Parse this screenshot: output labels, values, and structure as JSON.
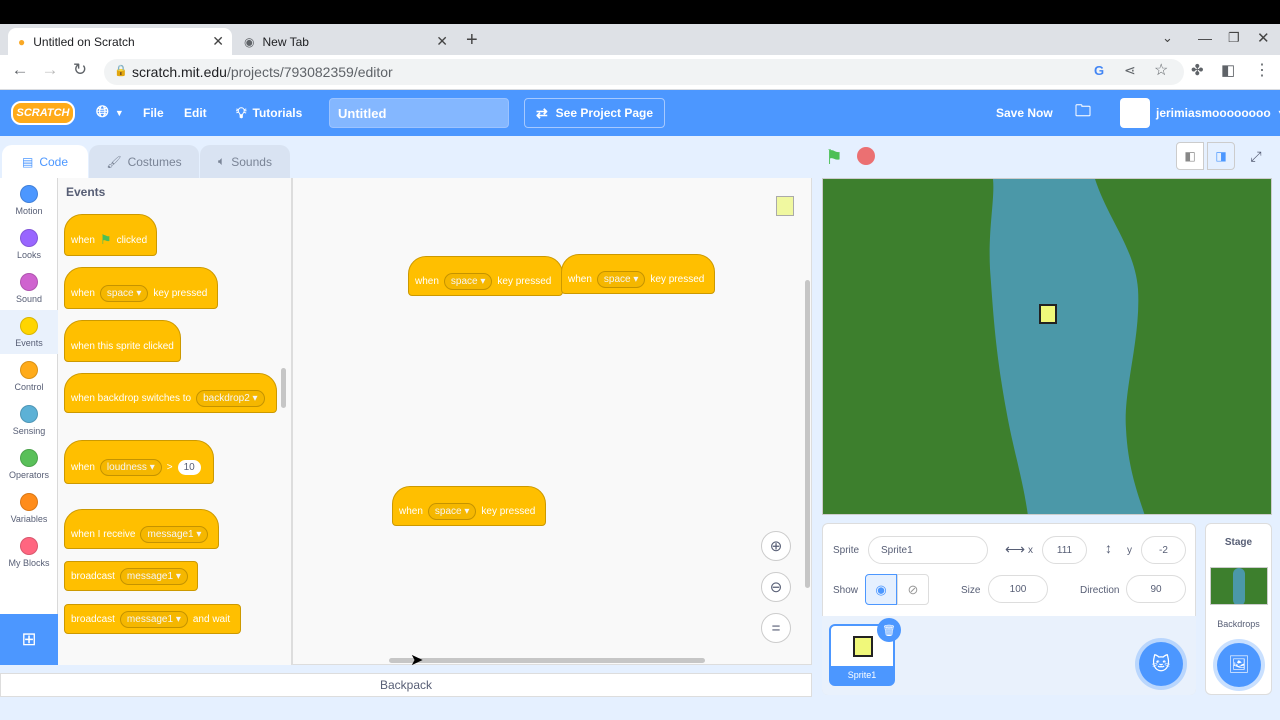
{
  "browser": {
    "tabs": [
      {
        "title": "Untitled on Scratch"
      },
      {
        "title": "New Tab"
      }
    ],
    "url_domain": "scratch.mit.edu",
    "url_path": "/projects/793082359/editor"
  },
  "menu": {
    "logo": "SCRATCH",
    "file": "File",
    "edit": "Edit",
    "tutorials": "Tutorials",
    "project_title": "Untitled",
    "see_project": "See Project Page",
    "save_now": "Save Now",
    "username": "jerimiasmoooooooo"
  },
  "editor_tabs": {
    "code": "Code",
    "costumes": "Costumes",
    "sounds": "Sounds"
  },
  "categories": [
    {
      "label": "Motion",
      "color": "#4c97ff"
    },
    {
      "label": "Looks",
      "color": "#9966ff"
    },
    {
      "label": "Sound",
      "color": "#cf63cf"
    },
    {
      "label": "Events",
      "color": "#ffd500"
    },
    {
      "label": "Control",
      "color": "#ffab19"
    },
    {
      "label": "Sensing",
      "color": "#5cb1d6"
    },
    {
      "label": "Operators",
      "color": "#59c059"
    },
    {
      "label": "Variables",
      "color": "#ff8c1a"
    },
    {
      "label": "My Blocks",
      "color": "#ff6680"
    }
  ],
  "palette": {
    "heading": "Events",
    "flag_when": "when",
    "flag_clicked": "clicked",
    "key_when": "when",
    "key_value": "space",
    "key_pressed": "key pressed",
    "sprite_clicked": "when this sprite clicked",
    "backdrop_text": "when backdrop switches to",
    "backdrop_value": "backdrop2",
    "loud_when": "when",
    "loud_value": "loudness",
    "loud_op": ">",
    "loud_num": "10",
    "receive_text": "when I receive",
    "receive_value": "message1",
    "broadcast_text": "broadcast",
    "broadcast_value": "message1",
    "bwait_text": "broadcast",
    "bwait_value": "message1",
    "bwait_end": "and wait"
  },
  "workspace": {
    "blocks": [
      {
        "when": "when",
        "key": "space",
        "pressed": "key pressed"
      },
      {
        "when": "when",
        "key": "space",
        "pressed": "key pressed"
      },
      {
        "when": "when",
        "key": "space",
        "pressed": "key pressed"
      }
    ]
  },
  "sprite_info": {
    "sprite_label": "Sprite",
    "sprite_name": "Sprite1",
    "x_label": "x",
    "x": "111",
    "y_label": "y",
    "y": "-2",
    "show_label": "Show",
    "size_label": "Size",
    "size": "100",
    "direction_label": "Direction",
    "direction": "90",
    "thumb_name": "Sprite1"
  },
  "stage_panel": {
    "title": "Stage",
    "backdrops": "Backdrops"
  },
  "backpack": "Backpack"
}
